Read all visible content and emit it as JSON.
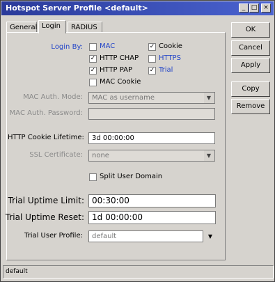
{
  "window": {
    "title": "Hotspot Server Profile <default>"
  },
  "titlebar_buttons": {
    "minimize": "_",
    "maximize": "□",
    "close": "×"
  },
  "tabs": [
    {
      "label": "General"
    },
    {
      "label": "Login"
    },
    {
      "label": "RADIUS"
    }
  ],
  "login_by": {
    "label": "Login By:",
    "options": [
      {
        "label": "MAC",
        "checked": false
      },
      {
        "label": "Cookie",
        "checked": true
      },
      {
        "label": "HTTP CHAP",
        "checked": true
      },
      {
        "label": "HTTPS",
        "checked": false
      },
      {
        "label": "HTTP PAP",
        "checked": true
      },
      {
        "label": "Trial",
        "checked": true
      },
      {
        "label": "MAC Cookie",
        "checked": false
      }
    ]
  },
  "mac_auth_mode": {
    "label": "MAC Auth. Mode:",
    "value": "MAC as username"
  },
  "mac_auth_password": {
    "label": "MAC Auth. Password:",
    "value": ""
  },
  "http_cookie_lifetime": {
    "label": "HTTP Cookie Lifetime:",
    "value": "3d 00:00:00"
  },
  "ssl_certificate": {
    "label": "SSL Certificate:",
    "value": "none"
  },
  "split_user_domain": {
    "label": "Split User Domain",
    "checked": false
  },
  "trial_uptime_limit": {
    "label": "Trial Uptime Limit:",
    "value": "00:30:00"
  },
  "trial_uptime_reset": {
    "label": "Trial Uptime Reset:",
    "value": "1d 00:00:00"
  },
  "trial_user_profile": {
    "label": "Trial User Profile:",
    "value": "default"
  },
  "buttons": {
    "ok": "OK",
    "cancel": "Cancel",
    "apply": "Apply",
    "copy": "Copy",
    "remove": "Remove"
  },
  "status": {
    "text": "default"
  },
  "icons": {
    "checkmark": "✓",
    "dropdown": "▼"
  }
}
